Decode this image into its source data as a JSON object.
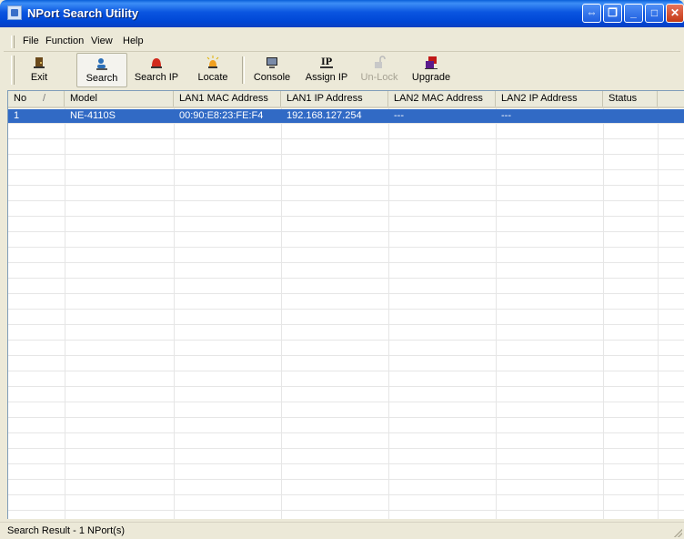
{
  "window": {
    "title": "NPort Search Utility",
    "buttons": {
      "extra1": "⇔",
      "extra2": "❐",
      "minimize": "_",
      "maximize": "□",
      "close": "✕"
    }
  },
  "menu": {
    "items": [
      {
        "label": "File"
      },
      {
        "label": "Function"
      },
      {
        "label": "View"
      },
      {
        "label": "Help"
      }
    ]
  },
  "toolbar": {
    "items": [
      {
        "label": "Exit",
        "icon": "exit-door-icon"
      },
      {
        "label": "Search",
        "icon": "search-person-icon",
        "pressed": true
      },
      {
        "label": "Search IP",
        "icon": "search-ip-alarm-icon"
      },
      {
        "label": "Locate",
        "icon": "locate-light-icon"
      },
      {
        "label": "Console",
        "icon": "console-monitor-icon"
      },
      {
        "label": "Assign IP",
        "icon": "assign-ip-icon"
      },
      {
        "label": "Un-Lock",
        "icon": "unlock-padlock-icon",
        "disabled": true
      },
      {
        "label": "Upgrade",
        "icon": "upgrade-chip-icon"
      }
    ]
  },
  "list": {
    "columns": [
      "No",
      "/",
      "Model",
      "LAN1 MAC Address",
      "LAN1 IP Address",
      "LAN2 MAC Address",
      "LAN2 IP Address",
      "Status"
    ],
    "rows": [
      {
        "no": "1",
        "model": "NE-4110S",
        "lan1_mac": "00:90:E8:23:FE:F4",
        "lan1_ip": "192.168.127.254",
        "lan2_mac": "---",
        "lan2_ip": "---",
        "status": ""
      }
    ]
  },
  "statusbar": {
    "text": "Search Result - 1 NPort(s)"
  },
  "colors": {
    "selection": "#316ac5",
    "titlebar": "#0a55e0"
  }
}
